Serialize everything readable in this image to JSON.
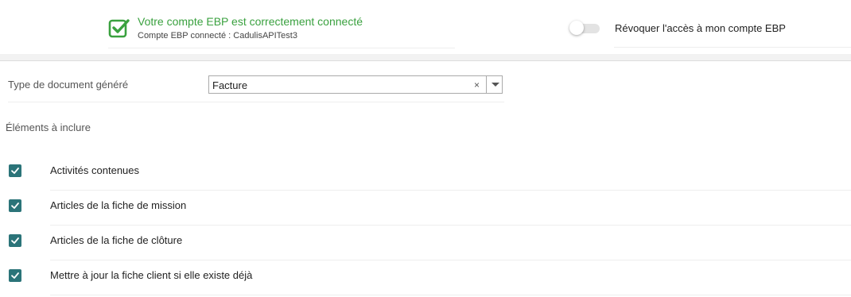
{
  "connection": {
    "status_title": "Votre compte EBP est correctement connecté",
    "account_info": "Compte EBP connecté : CadulisAPITest3",
    "status_icon": "checkbox-checked-icon",
    "status_color": "#3aa13f"
  },
  "revoke": {
    "label": "Révoquer l'accès à mon compte EBP",
    "enabled": false
  },
  "document_type": {
    "label": "Type de document généré",
    "selected": "Facture"
  },
  "elements": {
    "title": "Éléments à inclure",
    "items": [
      {
        "label": "Activités contenues",
        "checked": true
      },
      {
        "label": "Articles de la fiche de mission",
        "checked": true
      },
      {
        "label": "Articles de la fiche de clôture",
        "checked": true
      },
      {
        "label": "Mettre à jour la fiche client si elle existe déjà",
        "checked": true
      }
    ]
  },
  "colors": {
    "accent": "#2b7479",
    "success": "#3aa13f"
  }
}
